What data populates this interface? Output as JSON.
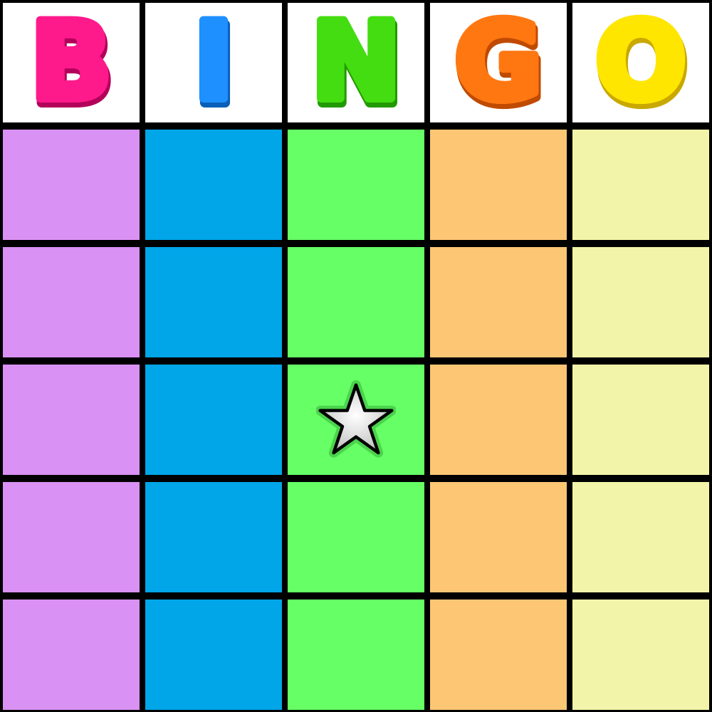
{
  "header": {
    "letters": [
      {
        "letter": "B",
        "color": "#ff1a8c",
        "shadow": "#b3005a"
      },
      {
        "letter": "I",
        "color": "#1e90ff",
        "shadow": "#0a5fb8"
      },
      {
        "letter": "N",
        "color": "#44dd11",
        "shadow": "#229900"
      },
      {
        "letter": "G",
        "color": "#ff7711",
        "shadow": "#c04a00"
      },
      {
        "letter": "O",
        "color": "#ffe600",
        "shadow": "#c9a800"
      }
    ]
  },
  "columns": [
    {
      "name": "B",
      "color": "#d991f3"
    },
    {
      "name": "I",
      "color": "#00a6e8"
    },
    {
      "name": "N",
      "color": "#66ff66"
    },
    {
      "name": "G",
      "color": "#fdc674"
    },
    {
      "name": "O",
      "color": "#f2f5a9"
    }
  ],
  "grid": {
    "rows": 5,
    "cols": 5,
    "cells": [
      [
        "",
        "",
        "",
        "",
        ""
      ],
      [
        "",
        "",
        "",
        "",
        ""
      ],
      [
        "",
        "",
        "free-space",
        "",
        ""
      ],
      [
        "",
        "",
        "",
        "",
        ""
      ],
      [
        "",
        "",
        "",
        "",
        ""
      ]
    ]
  },
  "free_space": {
    "row": 2,
    "col": 2,
    "icon": "star-icon",
    "fill": "#e6e6e6",
    "stroke": "#000000"
  }
}
